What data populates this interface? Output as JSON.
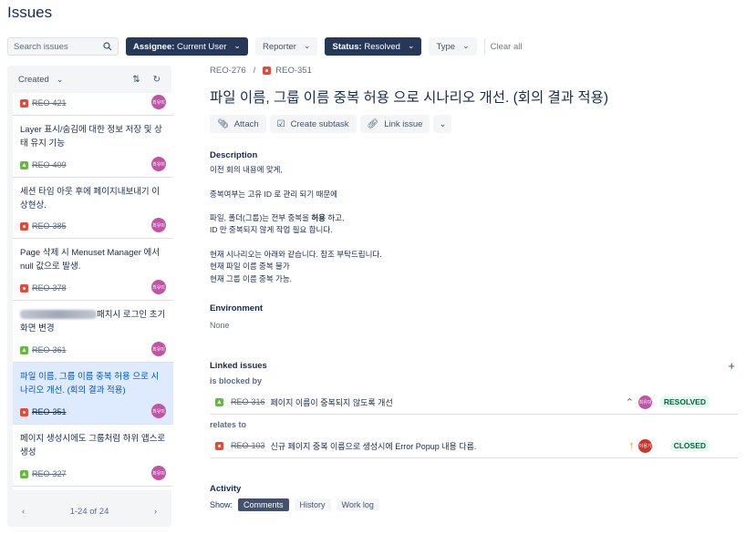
{
  "page": {
    "title": "Issues"
  },
  "filters": {
    "search_placeholder": "Search issues",
    "assignee_label": "Assignee:",
    "assignee_value": "Current User",
    "reporter": "Reporter",
    "status_label": "Status:",
    "status_value": "Resolved",
    "type": "Type",
    "clear": "Clear all"
  },
  "list": {
    "sort": "Created",
    "pager": "1-24 of 24",
    "items": [
      {
        "summary": "",
        "key": "REO-421",
        "type": "bug",
        "avatar": "최유미"
      },
      {
        "summary": "Layer 표시/숨김에 대한 정보 저장 및 상태 유지 기능",
        "key": "REO-409",
        "type": "story",
        "avatar": "최유미"
      },
      {
        "summary": "세션 타임 아웃 후에 페이지내보내기 이상현상.",
        "key": "REO-385",
        "type": "bug",
        "avatar": "최유미"
      },
      {
        "summary": "Page 삭제 시 Menuset Manager 에서 null 값으로 발생.",
        "key": "REO-378",
        "type": "bug",
        "avatar": "최유미"
      },
      {
        "summary": "패치시 로그인 초기 화면 변경",
        "key": "REO-361",
        "type": "story",
        "avatar": "최유미"
      },
      {
        "summary": "파일 이름, 그룹 이름 중복 허용 으로 시나리오 개선. (회의 결과 적용)",
        "key": "REO-351",
        "type": "bug",
        "avatar": "최유미"
      },
      {
        "summary": "페이지 생성시에도 그룹처럼 하위 앱스로 생성",
        "key": "REO-327",
        "type": "story",
        "avatar": "최유미"
      }
    ]
  },
  "detail": {
    "parent_key": "REO-276",
    "key": "REO-351",
    "title": "파일 이름, 그룹 이름 중복 허용 으로 시나리오 개선. (회의 결과 적용)",
    "actions": {
      "attach": "Attach",
      "subtask": "Create subtask",
      "link": "Link issue"
    },
    "description_label": "Description",
    "description": {
      "l1": "이전 회의 내용에 맞게,",
      "l2": "중복여부는 고유 ID 로 관리 되기 때문에",
      "l3a": "파일, 폴더(그룹)는 전부 중복을 ",
      "l3b": "허용",
      "l3c": " 하고,",
      "l4": "ID 만 중복되지 않게 작업 필요 합니다.",
      "l5": "현재 시나리오는 아래와 같습니다. 참조 부탁드립니다.",
      "l6": "현재 파일 이름 중복 불가",
      "l7": "현재 그룹 이름 중복 가능."
    },
    "environment_label": "Environment",
    "environment_value": "None",
    "linked_label": "Linked issues",
    "links": [
      {
        "relation": "is blocked by",
        "key": "REO-316",
        "summary": "페이지 이름이 중복되지 않도록 개선",
        "status": "RESOLVED",
        "avatar": "최유미",
        "avatar_color": "#C153A7",
        "priority_color": "#DE350B"
      },
      {
        "relation": "relates to",
        "key": "REO-103",
        "summary": "신규 페이지 중복 이름으로 생성시에 Error Popup 내용 다름.",
        "status": "CLOSED",
        "avatar": "이용기",
        "avatar_color": "#C9372C",
        "priority_color": "#FF8B00"
      }
    ],
    "activity_label": "Activity",
    "show_label": "Show:",
    "tabs": [
      "Comments",
      "History",
      "Work log"
    ]
  }
}
